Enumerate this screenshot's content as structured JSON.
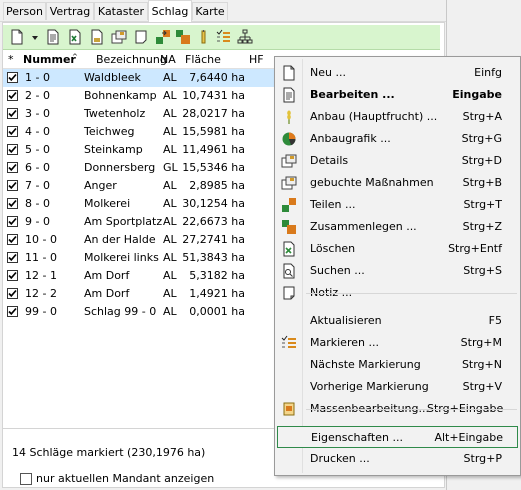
{
  "tabs": [
    "Person",
    "Vertrag",
    "Kataster",
    "Schlag",
    "Karte"
  ],
  "active_tab": "Schlag",
  "toolbar_icons": [
    "new-doc-icon",
    "dropdown-arrow-icon",
    "edit-doc-icon",
    "excel-export-icon",
    "report-icon",
    "details-icon",
    "notes-icon",
    "split-icon",
    "fertilizer-icon",
    "mark-list-icon",
    "tree-structure-icon"
  ],
  "grid": {
    "columns": [
      "*",
      "Nummer",
      "Bezeichnung",
      "NA",
      "Fläche",
      "HF"
    ],
    "rows": [
      {
        "nummer": "1 - 0",
        "bezeichnung": "Waldbleek",
        "na": "AL",
        "flaeche": "7,6440 ha",
        "checked": true,
        "selected": true
      },
      {
        "nummer": "2 - 0",
        "bezeichnung": "Bohnenkamp",
        "na": "AL",
        "flaeche": "10,7431 ha",
        "checked": true
      },
      {
        "nummer": "3 - 0",
        "bezeichnung": "Twetenholz",
        "na": "AL",
        "flaeche": "28,0217 ha",
        "checked": true
      },
      {
        "nummer": "4 - 0",
        "bezeichnung": "Teichweg",
        "na": "AL",
        "flaeche": "15,5981 ha",
        "checked": true
      },
      {
        "nummer": "5 - 0",
        "bezeichnung": "Steinkamp",
        "na": "AL",
        "flaeche": "11,4961 ha",
        "checked": true
      },
      {
        "nummer": "6 - 0",
        "bezeichnung": "Donnersberg",
        "na": "GL",
        "flaeche": "15,5346 ha",
        "checked": true
      },
      {
        "nummer": "7 - 0",
        "bezeichnung": "Anger",
        "na": "AL",
        "flaeche": "2,8985 ha",
        "checked": true
      },
      {
        "nummer": "8 - 0",
        "bezeichnung": "Molkerei",
        "na": "AL",
        "flaeche": "30,1254 ha",
        "checked": true
      },
      {
        "nummer": "9 - 0",
        "bezeichnung": "Am Sportplatz",
        "na": "AL",
        "flaeche": "22,6673 ha",
        "checked": true
      },
      {
        "nummer": "10 - 0",
        "bezeichnung": "An der Halde",
        "na": "AL",
        "flaeche": "27,2741 ha",
        "checked": true
      },
      {
        "nummer": "11 - 0",
        "bezeichnung": "Molkerei links",
        "na": "AL",
        "flaeche": "51,3843 ha",
        "checked": true
      },
      {
        "nummer": "12 - 1",
        "bezeichnung": "Am Dorf",
        "na": "AL",
        "flaeche": "5,3182 ha",
        "checked": true
      },
      {
        "nummer": "12 - 2",
        "bezeichnung": "Am Dorf",
        "na": "AL",
        "flaeche": "1,4921 ha",
        "checked": true
      },
      {
        "nummer": "99 - 0",
        "bezeichnung": "Schlag 99 - 0",
        "na": "AL",
        "flaeche": "0,0001 ha",
        "checked": true
      }
    ]
  },
  "status_text": "14 Schläge markiert (230,1976 ha)",
  "bottom_checkbox_label": "nur aktuellen Mandant anzeigen",
  "bottom_checkbox_checked": false,
  "context_menu": {
    "items": [
      {
        "label": "Neu ...",
        "shortcut": "Einfg",
        "icon": "new-doc-icon"
      },
      {
        "label": "Bearbeiten ...",
        "shortcut": "Eingabe",
        "icon": "edit-doc-icon",
        "bold": true
      },
      {
        "label": "Anbau (Hauptfrucht) ...",
        "shortcut": "Strg+A",
        "icon": "crop-icon"
      },
      {
        "label": "Anbaugrafik ...",
        "shortcut": "Strg+G",
        "icon": "pie-chart-icon"
      },
      {
        "label": "Details",
        "shortcut": "Strg+D",
        "icon": "details-icon"
      },
      {
        "label": "gebuchte Maßnahmen",
        "shortcut": "Strg+B",
        "icon": "measures-icon"
      },
      {
        "label": "Teilen ...",
        "shortcut": "Strg+T",
        "icon": "split-icon"
      },
      {
        "label": "Zusammenlegen ...",
        "shortcut": "Strg+Z",
        "icon": "merge-icon"
      },
      {
        "label": "Löschen",
        "shortcut": "Strg+Entf",
        "icon": "delete-icon"
      },
      {
        "label": "Suchen ...",
        "shortcut": "Strg+S",
        "icon": "search-icon"
      },
      {
        "label": "Notiz ...",
        "shortcut": "",
        "icon": "note-icon"
      },
      {
        "label": "Aktualisieren",
        "shortcut": "F5",
        "icon": ""
      },
      {
        "label": "Markieren ...",
        "shortcut": "Strg+M",
        "icon": "mark-list-icon"
      },
      {
        "label": "Nächste Markierung",
        "shortcut": "Strg+N",
        "icon": ""
      },
      {
        "label": "Vorherige Markierung",
        "shortcut": "Strg+V",
        "icon": ""
      },
      {
        "label": "Massenbearbeitung...",
        "shortcut": "Strg+Eingabe",
        "icon": "mass-edit-icon"
      },
      {
        "label": "Eigenschaften ...",
        "shortcut": "Alt+Eingabe",
        "icon": "",
        "focused": true
      },
      {
        "label": "Drucken ...",
        "shortcut": "Strg+P",
        "icon": ""
      }
    ]
  },
  "colors": {
    "toolbar_bg": "#d8f5ce",
    "selected_row": "#cde8ff",
    "focus_border": "#2f8a4a",
    "menu_bg": "#f2f2f2"
  }
}
